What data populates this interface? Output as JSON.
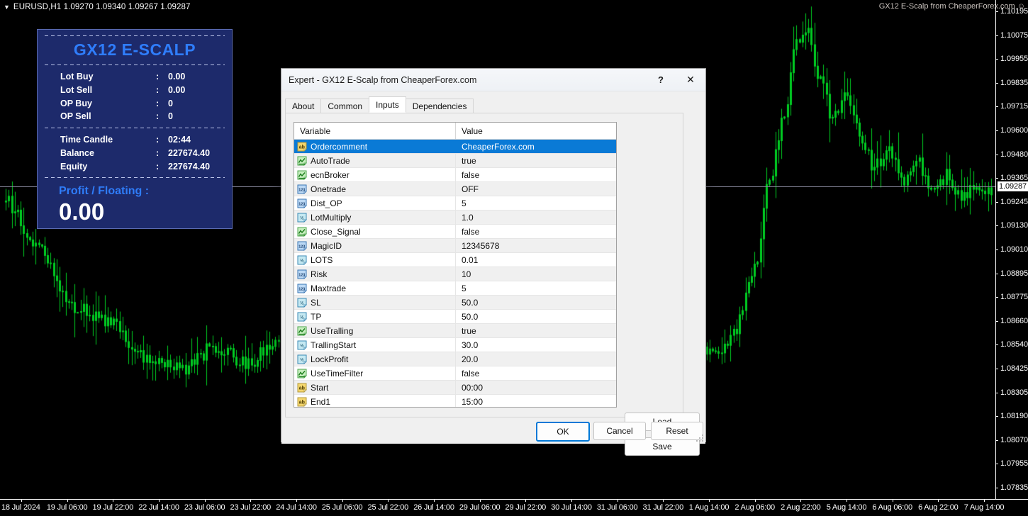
{
  "chart": {
    "symbol_line": "EURUSD,H1  1.09270 1.09340 1.09267 1.09287",
    "symbol": "EURUSD,H1",
    "ohlc": {
      "open": "1.09270",
      "high": "1.09340",
      "low": "1.09267",
      "close": "1.09287"
    },
    "caret": "▼",
    "watermark": "GX12 E-Scalp from CheaperForex.com ☺",
    "background_color": "#000000",
    "candle_color": "#00cc22",
    "axis_color": "#ffffff",
    "current_price": "1.09287",
    "price_ticks": [
      "1.10195",
      "1.10075",
      "1.09955",
      "1.09835",
      "1.09715",
      "1.09600",
      "1.09480",
      "1.09365",
      "1.09245",
      "1.09130",
      "1.09010",
      "1.08895",
      "1.08775",
      "1.08660",
      "1.08540",
      "1.08425",
      "1.08305",
      "1.08190",
      "1.08070",
      "1.07955",
      "1.07835"
    ],
    "time_ticks": [
      "18 Jul 2024",
      "19 Jul 06:00",
      "19 Jul 22:00",
      "22 Jul 14:00",
      "23 Jul 06:00",
      "23 Jul 22:00",
      "24 Jul 14:00",
      "25 Jul 06:00",
      "25 Jul 22:00",
      "26 Jul 14:00",
      "29 Jul 06:00",
      "29 Jul 22:00",
      "30 Jul 14:00",
      "31 Jul 06:00",
      "31 Jul 22:00",
      "1 Aug 14:00",
      "2 Aug 06:00",
      "2 Aug 22:00",
      "5 Aug 14:00",
      "6 Aug 06:00",
      "6 Aug 22:00",
      "7 Aug 14:00"
    ]
  },
  "ea_panel": {
    "title": "GX12 E-SCALP",
    "colon": ":",
    "stats": [
      {
        "label": "Lot Buy",
        "value": "0.00"
      },
      {
        "label": "Lot Sell",
        "value": "0.00"
      },
      {
        "label": "OP Buy",
        "value": "0"
      },
      {
        "label": "OP Sell",
        "value": "0"
      }
    ],
    "account": [
      {
        "label": "Time Candle",
        "value": "02:44"
      },
      {
        "label": "Balance",
        "value": "227674.40"
      },
      {
        "label": "Equity",
        "value": "227674.40"
      }
    ],
    "profit_label": "Profit / Floating  :",
    "profit_value": "0.00",
    "bg_color": "#1d2a6b",
    "accent_color": "#2f7dfb"
  },
  "dialog": {
    "title": "Expert - GX12 E-Scalp from CheaperForex.com",
    "help_glyph": "?",
    "close_glyph": "✕",
    "tabs": [
      {
        "label": "About",
        "active": false
      },
      {
        "label": "Common",
        "active": false
      },
      {
        "label": "Inputs",
        "active": true
      },
      {
        "label": "Dependencies",
        "active": false
      }
    ],
    "grid": {
      "columns": [
        "Variable",
        "Value"
      ],
      "rows": [
        {
          "icon": "string-icon",
          "variable": "Ordercomment",
          "value": "CheaperForex.com",
          "selected": true
        },
        {
          "icon": "bool-icon",
          "variable": "AutoTrade",
          "value": "true",
          "selected": false
        },
        {
          "icon": "bool-icon",
          "variable": "ecnBroker",
          "value": "false",
          "selected": false
        },
        {
          "icon": "int-icon",
          "variable": "Onetrade",
          "value": "OFF",
          "selected": false
        },
        {
          "icon": "int-icon",
          "variable": "Dist_OP",
          "value": "5",
          "selected": false
        },
        {
          "icon": "double-icon",
          "variable": "LotMultiply",
          "value": "1.0",
          "selected": false
        },
        {
          "icon": "bool-icon",
          "variable": "Close_Signal",
          "value": "false",
          "selected": false
        },
        {
          "icon": "int-icon",
          "variable": "MagicID",
          "value": "12345678",
          "selected": false
        },
        {
          "icon": "double-icon",
          "variable": "LOTS",
          "value": "0.01",
          "selected": false
        },
        {
          "icon": "int-icon",
          "variable": "Risk",
          "value": "10",
          "selected": false
        },
        {
          "icon": "int-icon",
          "variable": "Maxtrade",
          "value": "5",
          "selected": false
        },
        {
          "icon": "double-icon",
          "variable": "SL",
          "value": "50.0",
          "selected": false
        },
        {
          "icon": "double-icon",
          "variable": "TP",
          "value": "50.0",
          "selected": false
        },
        {
          "icon": "bool-icon",
          "variable": "UseTralling",
          "value": "true",
          "selected": false
        },
        {
          "icon": "double-icon",
          "variable": "TrallingStart",
          "value": "30.0",
          "selected": false
        },
        {
          "icon": "double-icon",
          "variable": "LockProfit",
          "value": "20.0",
          "selected": false
        },
        {
          "icon": "bool-icon",
          "variable": "UseTimeFilter",
          "value": "false",
          "selected": false
        },
        {
          "icon": "string-icon",
          "variable": "Start",
          "value": "00:00",
          "selected": false
        },
        {
          "icon": "string-icon",
          "variable": "End1",
          "value": "15:00",
          "selected": false
        }
      ]
    },
    "side_buttons": [
      {
        "label": "Load"
      },
      {
        "label": "Save"
      }
    ],
    "footer_buttons": [
      {
        "label": "OK",
        "primary": true
      },
      {
        "label": "Cancel",
        "primary": false
      },
      {
        "label": "Reset",
        "primary": false
      }
    ],
    "selection_color": "#0a7ad6"
  }
}
